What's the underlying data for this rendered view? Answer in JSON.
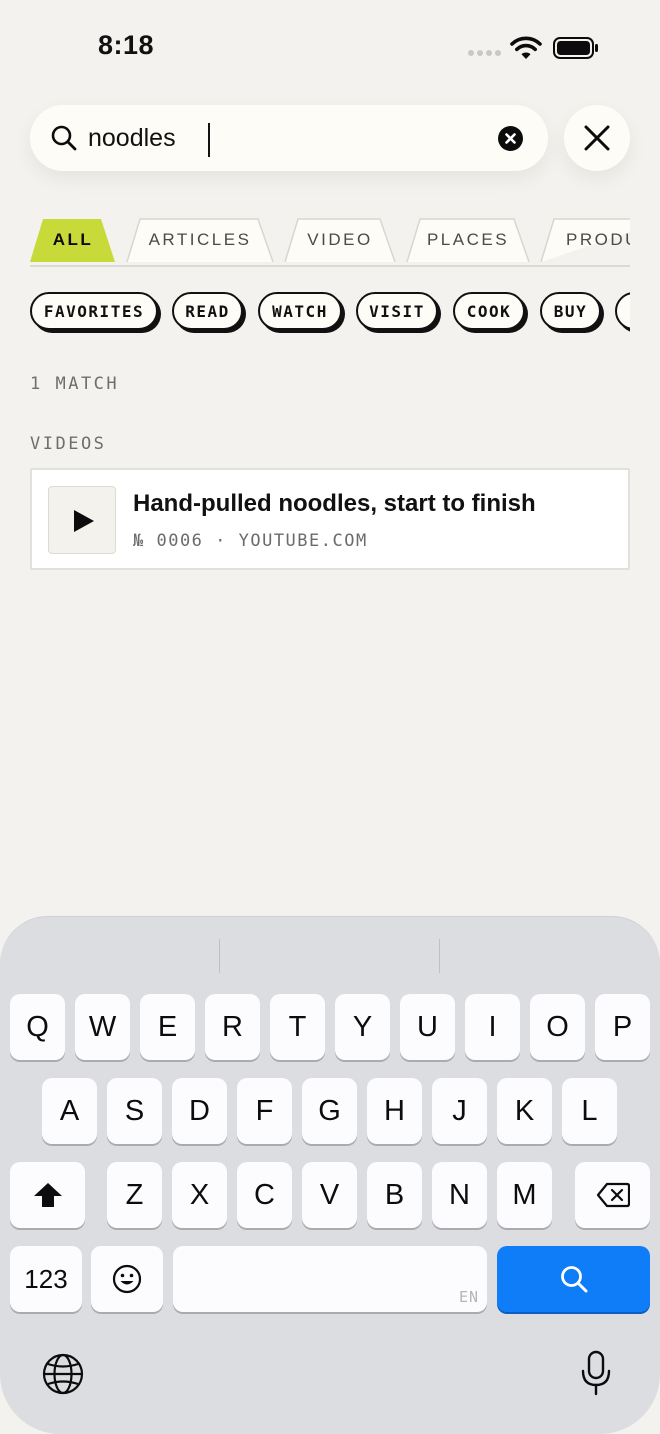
{
  "status": {
    "time": "8:18"
  },
  "search": {
    "query": "noodles"
  },
  "tabs": [
    {
      "label": "ALL",
      "active": true
    },
    {
      "label": "ARTICLES",
      "active": false
    },
    {
      "label": "VIDEO",
      "active": false
    },
    {
      "label": "PLACES",
      "active": false
    },
    {
      "label": "PRODU",
      "active": false
    }
  ],
  "chips": [
    {
      "label": "FAVORITES"
    },
    {
      "label": "READ"
    },
    {
      "label": "WATCH"
    },
    {
      "label": "VISIT"
    },
    {
      "label": "COOK"
    },
    {
      "label": "BUY"
    },
    {
      "label": ""
    }
  ],
  "results": {
    "count_label": "1 MATCH",
    "section_label": "VIDEOS",
    "items": [
      {
        "title": "Hand-pulled noodles, start to finish",
        "meta": "№ 0006 · YOUTUBE.COM"
      }
    ]
  },
  "keyboard": {
    "row1": [
      "Q",
      "W",
      "E",
      "R",
      "T",
      "Y",
      "U",
      "I",
      "O",
      "P"
    ],
    "row2": [
      "A",
      "S",
      "D",
      "F",
      "G",
      "H",
      "J",
      "K",
      "L"
    ],
    "row3": [
      "Z",
      "X",
      "C",
      "V",
      "B",
      "N",
      "M"
    ],
    "numbers_label": "123",
    "language_label": "EN"
  },
  "colors": {
    "accent": "#c8d93a",
    "search_key": "#0f7cf8",
    "background": "#f4f2ee"
  }
}
